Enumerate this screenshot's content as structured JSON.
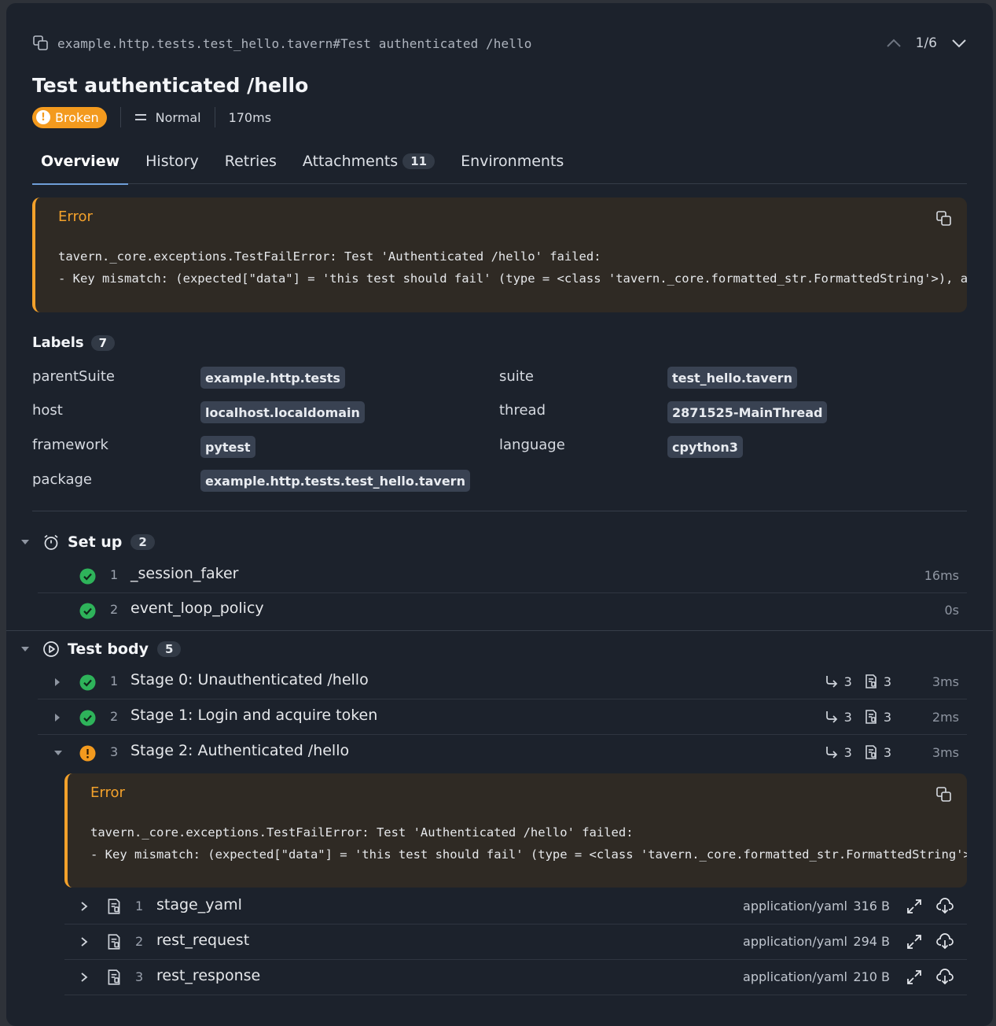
{
  "header": {
    "path": "example.http.tests.test_hello.tavern#Test authenticated /hello",
    "nav_count": "1/6"
  },
  "test": {
    "title": "Test authenticated /hello",
    "status": "Broken",
    "severity": "Normal",
    "duration": "170ms"
  },
  "tabs": [
    {
      "label": "Overview"
    },
    {
      "label": "History"
    },
    {
      "label": "Retries"
    },
    {
      "label": "Attachments",
      "count": "11"
    },
    {
      "label": "Environments"
    }
  ],
  "error": {
    "title": "Error",
    "line1": "tavern._core.exceptions.TestFailError: Test 'Authenticated /hello' failed:",
    "line2": "- Key mismatch: (expected[\"data\"] = 'this test should fail' (type = <class 'tavern._core.formatted_str.FormattedString'>), actual[\"data\"] = 'Hello, Test'"
  },
  "labels": {
    "title": "Labels",
    "count": "7",
    "left": [
      {
        "key": "parentSuite",
        "value": "example.http.tests"
      },
      {
        "key": "host",
        "value": "localhost.localdomain"
      },
      {
        "key": "framework",
        "value": "pytest"
      },
      {
        "key": "package",
        "value": "example.http.tests.test_hello.tavern"
      }
    ],
    "right": [
      {
        "key": "suite",
        "value": "test_hello.tavern"
      },
      {
        "key": "thread",
        "value": "2871525-MainThread"
      },
      {
        "key": "language",
        "value": "cpython3"
      }
    ]
  },
  "setup": {
    "title": "Set up",
    "count": "2",
    "steps": [
      {
        "num": "1",
        "name": "_session_faker",
        "time": "16ms"
      },
      {
        "num": "2",
        "name": "event_loop_policy",
        "time": "0s"
      }
    ]
  },
  "body": {
    "title": "Test body",
    "count": "5",
    "steps": [
      {
        "num": "1",
        "name": "Stage 0: Unauthenticated /hello",
        "substeps": "3",
        "attachments": "3",
        "time": "3ms"
      },
      {
        "num": "2",
        "name": "Stage 1: Login and acquire token",
        "substeps": "3",
        "attachments": "3",
        "time": "2ms"
      },
      {
        "num": "3",
        "name": "Stage 2: Authenticated /hello",
        "substeps": "3",
        "attachments": "3",
        "time": "3ms"
      }
    ],
    "attachments": [
      {
        "num": "1",
        "name": "stage_yaml",
        "mime": "application/yaml",
        "size": "316 B"
      },
      {
        "num": "2",
        "name": "rest_request",
        "mime": "application/yaml",
        "size": "294 B"
      },
      {
        "num": "3",
        "name": "rest_response",
        "mime": "application/yaml",
        "size": "210 B"
      }
    ]
  },
  "colors": {
    "broken": "#f39a1e",
    "passed": "#2eb35a",
    "accent": "#6f9ed8"
  }
}
